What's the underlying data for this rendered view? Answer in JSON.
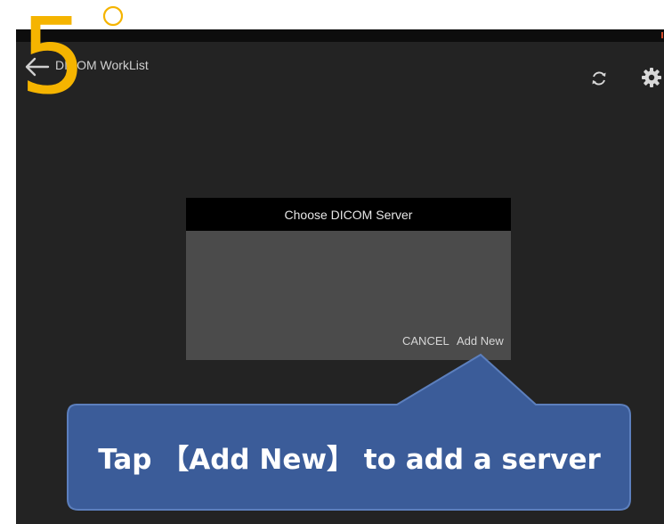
{
  "app": {
    "title": "DICOM WorkList"
  },
  "icons": {
    "back": "arrow-left-icon",
    "refresh": "sync-icon",
    "settings": "gear-icon"
  },
  "dialog": {
    "title": "Choose DICOM Server",
    "cancel_label": "CANCEL",
    "add_new_label": "Add New"
  },
  "annotation": {
    "step_number": "5",
    "callout_text": "Tap 【Add New】 to add a server"
  },
  "colors": {
    "screen_background": "#232323",
    "dialog_header": "#000000",
    "dialog_body": "#4b4b4b",
    "step_number": "#f5b400",
    "callout": "#3b5c99",
    "callout_border": "#5c7fbd"
  }
}
